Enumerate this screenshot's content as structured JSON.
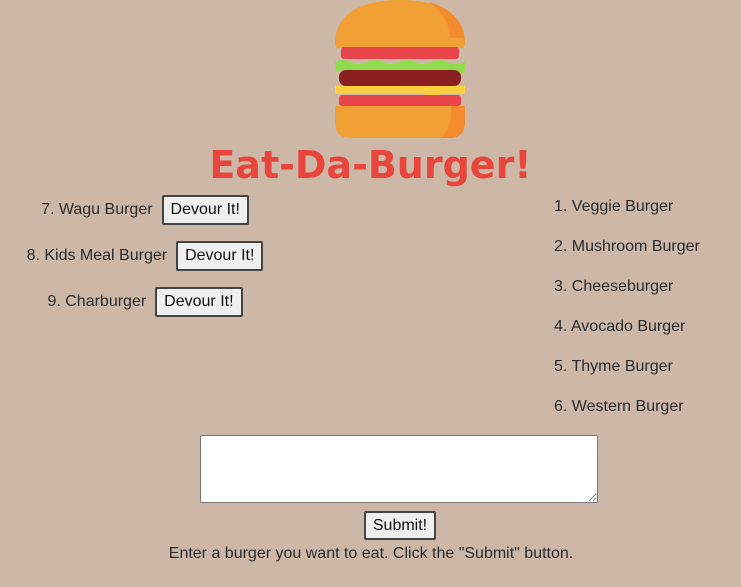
{
  "header": {
    "title": "Eat-Da-Burger!",
    "logo_icon": "hamburger-icon",
    "title_color": "#e8453c"
  },
  "uneaten": [
    {
      "label": "7. Wagu Burger",
      "button_label": "Devour It!"
    },
    {
      "label": "8. Kids Meal Burger",
      "button_label": "Devour It!"
    },
    {
      "label": "9. Charburger",
      "button_label": "Devour It!"
    }
  ],
  "eaten": [
    {
      "label": "1. Veggie Burger"
    },
    {
      "label": "2. Mushroom Burger"
    },
    {
      "label": "3. Cheeseburger"
    },
    {
      "label": "4. Avocado Burger"
    },
    {
      "label": "5. Thyme Burger"
    },
    {
      "label": "6. Western Burger"
    }
  ],
  "form": {
    "input_value": "",
    "submit_label": "Submit!",
    "instructions": "Enter a burger you want to eat. Click the \"Submit\" button."
  },
  "theme": {
    "background": "#cdb8a8"
  }
}
